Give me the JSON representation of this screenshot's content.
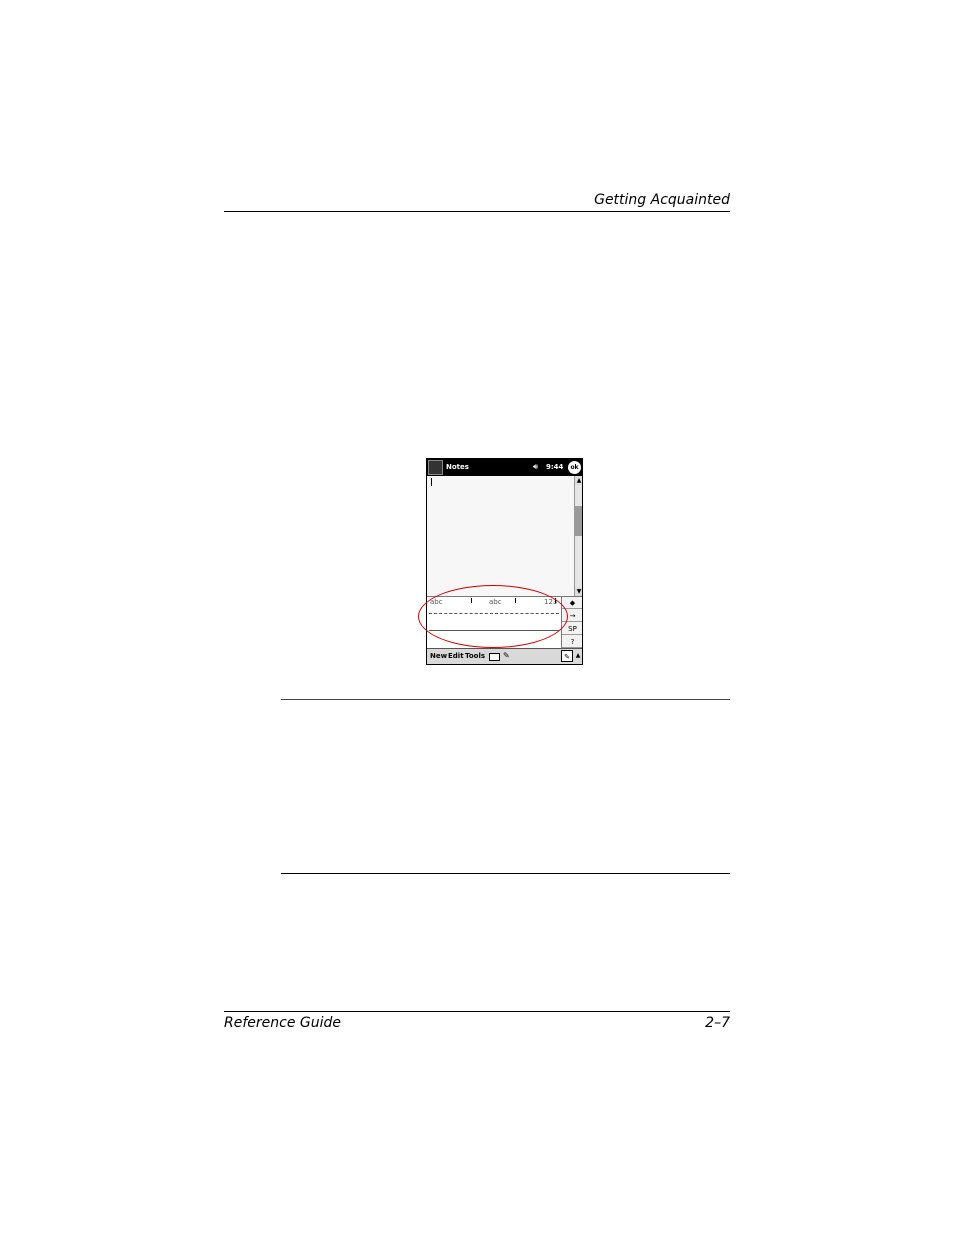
{
  "header": {
    "title": "Getting Acquainted"
  },
  "footer": {
    "left": "Reference Guide",
    "right": "2–7"
  },
  "screenshot": {
    "app_title": "Notes",
    "time": "9:44",
    "ok_label": "ok",
    "input_zone_labels": [
      "abc",
      "abc",
      "123"
    ],
    "side_buttons": [
      "◆",
      "→",
      "SP",
      "?",
      ""
    ],
    "menu_items": [
      "New",
      "Edit",
      "Tools"
    ],
    "annotation_color": "#d40000"
  }
}
